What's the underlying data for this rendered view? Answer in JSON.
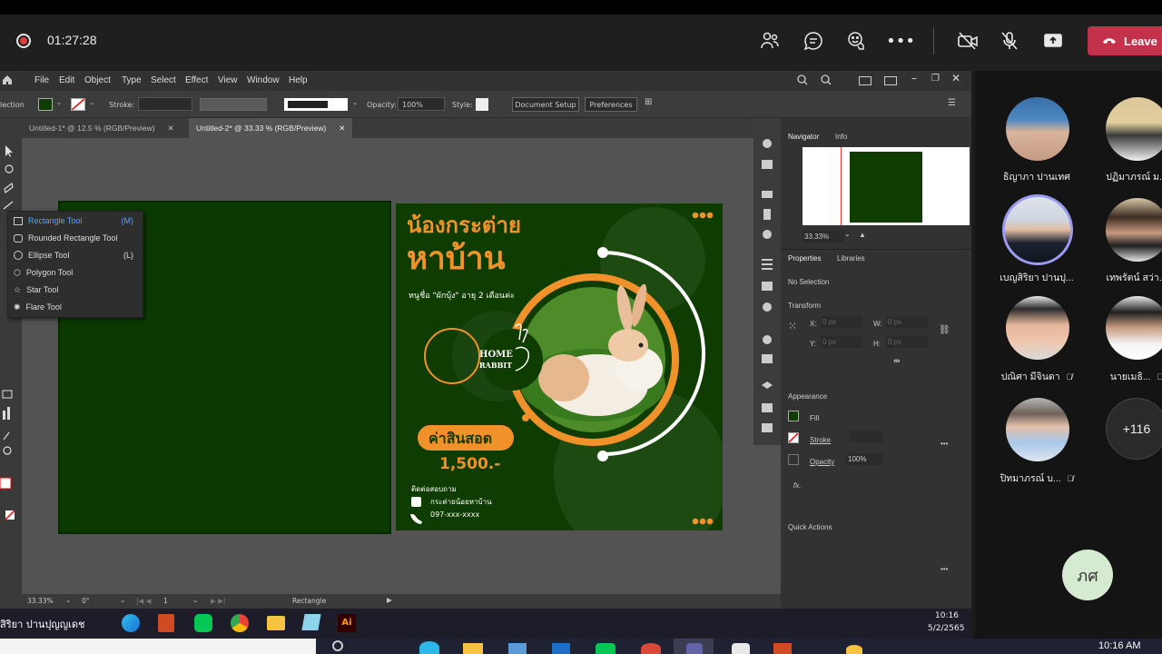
{
  "meeting": {
    "timer": "01:27:28",
    "leave_label": "Leave"
  },
  "illustrator": {
    "menu": [
      "File",
      "Edit",
      "Object",
      "Type",
      "Select",
      "Effect",
      "View",
      "Window",
      "Help"
    ],
    "control": {
      "selection_label": "lection",
      "stroke_label": "Stroke:",
      "opacity_label": "Opacity:",
      "opacity_value": "100%",
      "style_label": "Style:",
      "doc_setup_label": "Document Setup",
      "preferences_label": "Preferences"
    },
    "tabs": [
      {
        "label": "Untitled-1* @ 12.5 % (RGB/Preview)"
      },
      {
        "label": "Untitled-2* @ 33.33 % (RGB/Preview)"
      }
    ],
    "flyout": [
      {
        "label": "Rectangle Tool",
        "shortcut": "(M)"
      },
      {
        "label": "Rounded Rectangle Tool",
        "shortcut": ""
      },
      {
        "label": "Ellipse Tool",
        "shortcut": "(L)"
      },
      {
        "label": "Polygon Tool",
        "shortcut": ""
      },
      {
        "label": "Star Tool",
        "shortcut": ""
      },
      {
        "label": "Flare Tool",
        "shortcut": ""
      }
    ],
    "status": {
      "zoom": "33.33%",
      "rotation": "0°",
      "artboard": "1",
      "tool": "Rectangle"
    },
    "panel": {
      "navigator_tab": "Navigator",
      "info_tab": "Info",
      "nav_zoom": "33.33%",
      "properties_tab": "Properties",
      "libraries_tab": "Libraries",
      "no_selection": "No Selection",
      "transform_label": "Transform",
      "x_label": "X:",
      "y_label": "Y:",
      "w_label": "W:",
      "h_label": "H:",
      "xy_value": "0 px",
      "appearance_label": "Appearance",
      "fill_label": "Fill",
      "stroke_label": "Stroke",
      "opacity_label": "Opacity",
      "opacity_value": "100%",
      "fx_label": "fx.",
      "quick_actions_label": "Quick Actions"
    },
    "clock": {
      "time": "10:16",
      "date": "5/2/2565"
    }
  },
  "poster": {
    "title_line1": "น้องกระต่าย",
    "title_line2": "หาบ้าน",
    "subtitle": "หนูชื่อ \"ผักบุ้ง\" อายุ 2 เดือนค่ะ",
    "logo_line1": "HOME",
    "logo_line2": "RABBIT",
    "price_label": "ค่าสินสอด",
    "price_value": "1,500.-",
    "contact_label": "ติดต่อสอบถาม",
    "facebook": "กระต่ายน้อยหาบ้าน",
    "phone": "097-xxx-xxxx"
  },
  "participants": [
    {
      "name": "ธิญาภา ปานเทศ",
      "muted": false
    },
    {
      "name": "ปฏิมาภรณ์ ม...",
      "muted": false
    },
    {
      "name": "เบญสิริยา ปานปุ...",
      "muted": false
    },
    {
      "name": "เทพรัตน์ สว่า...",
      "muted": false
    },
    {
      "name": "ปณิศา มีจินดา",
      "muted": true
    },
    {
      "name": "นายเมธิ...",
      "muted": true
    },
    {
      "name": "ปิทมาภรณ์ บ...",
      "muted": true
    }
  ],
  "more_count": "+116",
  "self_initials": "ภศ",
  "presenter_label": "สิริยา ปานปุญญเดช",
  "os_time": "10:16 AM",
  "colors": {
    "poster_green": "#0f3c00",
    "accent_orange": "#f0912a",
    "leave_red": "#c4314b"
  }
}
